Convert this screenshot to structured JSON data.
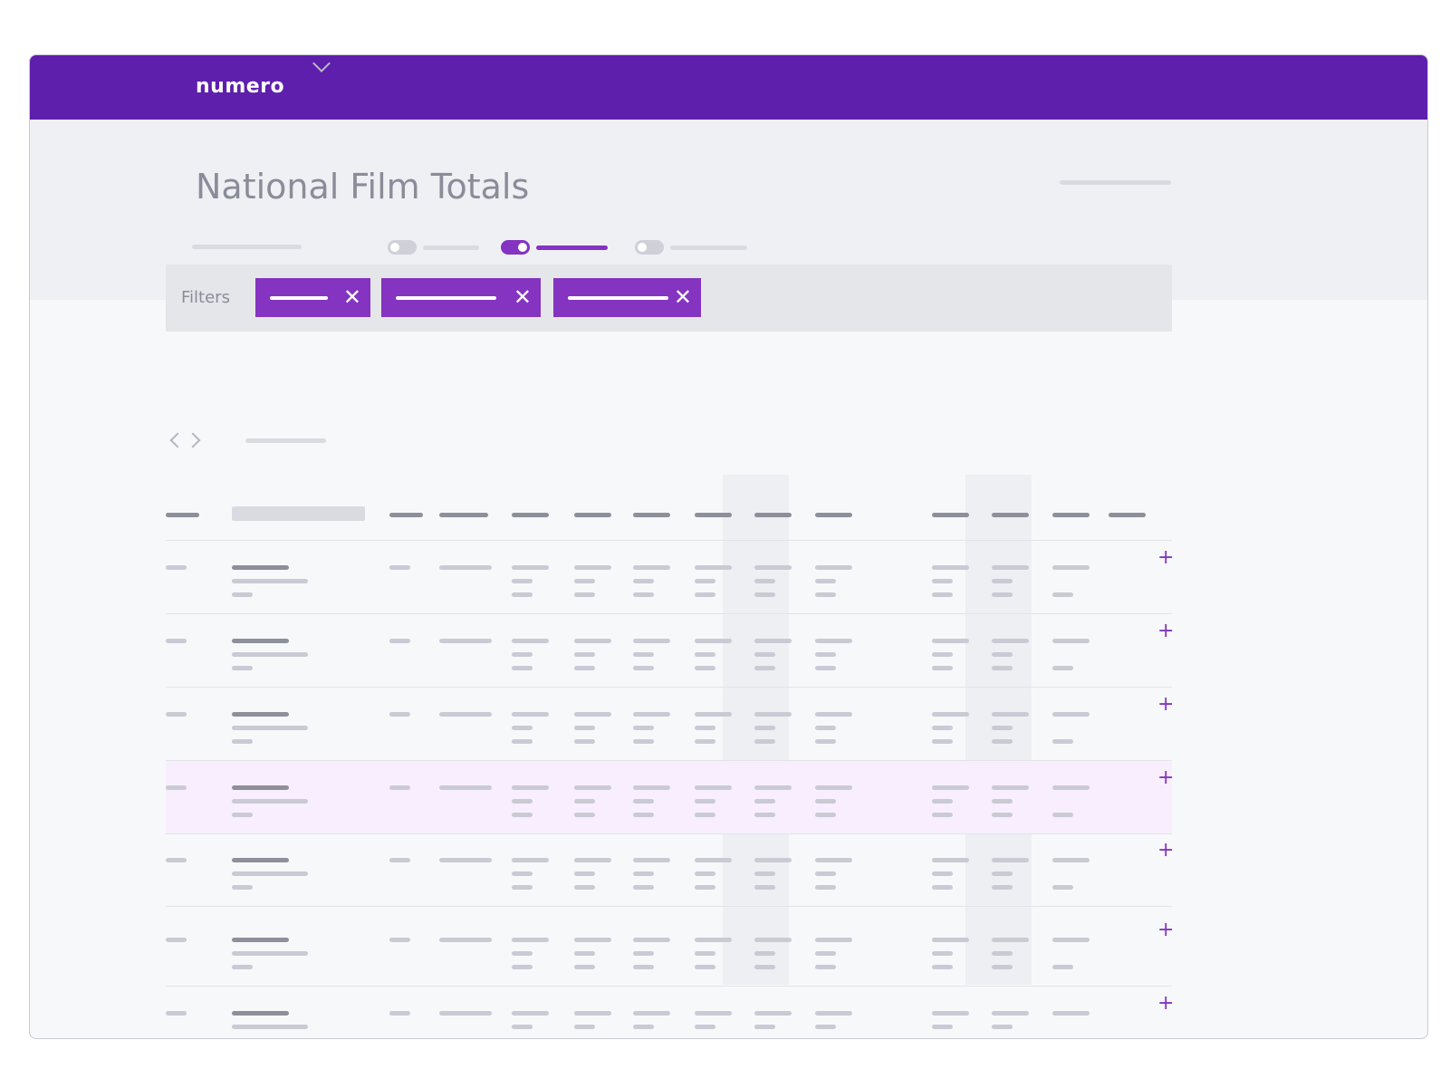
{
  "app": {
    "name": "numero"
  },
  "page": {
    "title": "National Film Totals"
  },
  "filters": {
    "label": "Filters",
    "chips": [
      {
        "remove_icon": "close-icon"
      },
      {
        "remove_icon": "close-icon"
      },
      {
        "remove_icon": "close-icon"
      }
    ]
  },
  "toggles": [
    {
      "state": "off"
    },
    {
      "state": "on"
    },
    {
      "state": "off"
    }
  ],
  "table": {
    "row_count_visible": 7,
    "selected_row": 4,
    "row_action": "+"
  },
  "icons": {
    "close": "✕",
    "add": "+",
    "dropdown": "chevron-down-icon",
    "prev": "chevron-left-icon",
    "next": "chevron-right-icon"
  },
  "colors": {
    "brand": "#5e1fac",
    "accent": "#8434c0",
    "selected_row": "#f8eefd"
  }
}
